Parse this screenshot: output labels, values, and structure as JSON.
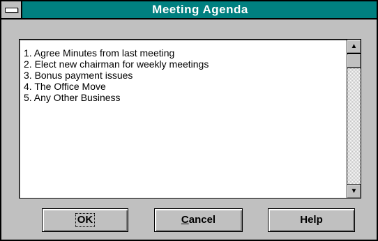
{
  "window": {
    "title": "Meeting Agenda",
    "icons": {
      "system_menu": "system-menu-icon"
    }
  },
  "agenda": {
    "items": [
      "1. Agree Minutes from last meeting",
      "2. Elect new chairman for weekly meetings",
      "3. Bonus payment issues",
      "4. The Office Move",
      "5. Any Other Business"
    ]
  },
  "scrollbar": {
    "up_icon": "up-arrow-icon",
    "down_icon": "down-arrow-icon"
  },
  "buttons": {
    "ok_label": "OK",
    "cancel_mnemonic": "C",
    "cancel_rest": "ancel",
    "help_label": "Help"
  },
  "colors": {
    "title_bar": "#008080",
    "face": "#c0c0c0"
  }
}
